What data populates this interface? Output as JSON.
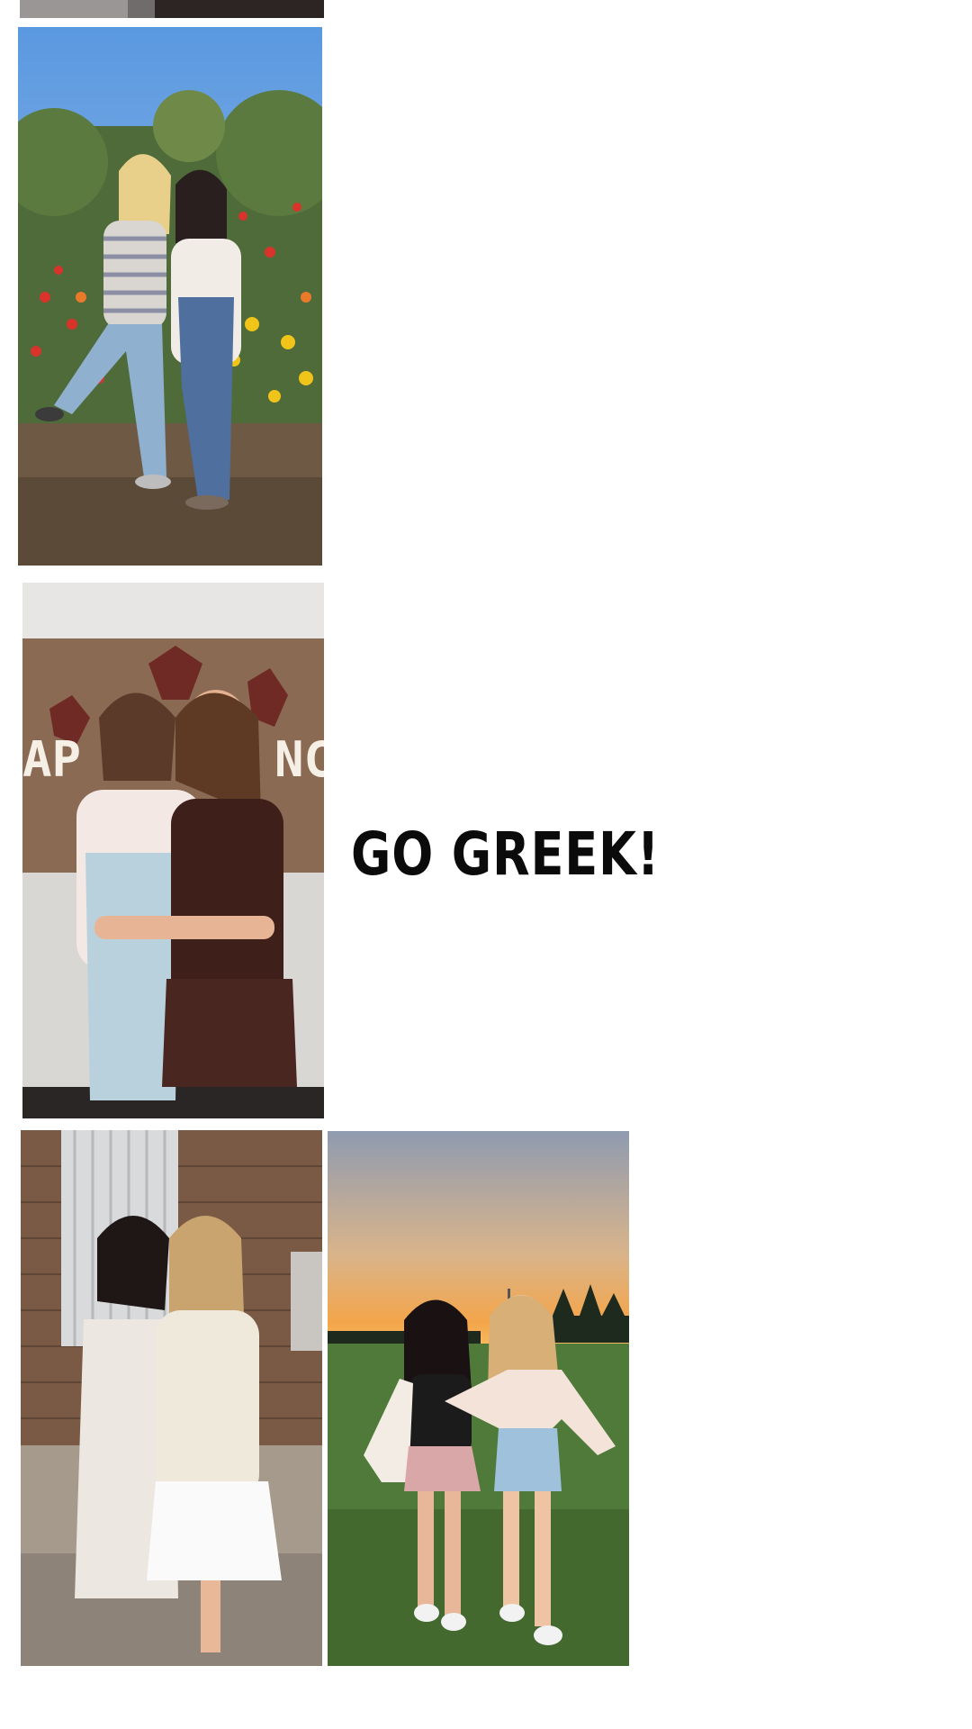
{
  "caption": {
    "text": "GO GREEK!"
  },
  "colors": {
    "background": "#ffffff",
    "caption_text": "#0b0b0b"
  },
  "photos": [
    "top-cropped-photo",
    "flower-garden-photo",
    "sorority-banner-photo",
    "brick-porch-photo",
    "sunset-field-photo"
  ]
}
